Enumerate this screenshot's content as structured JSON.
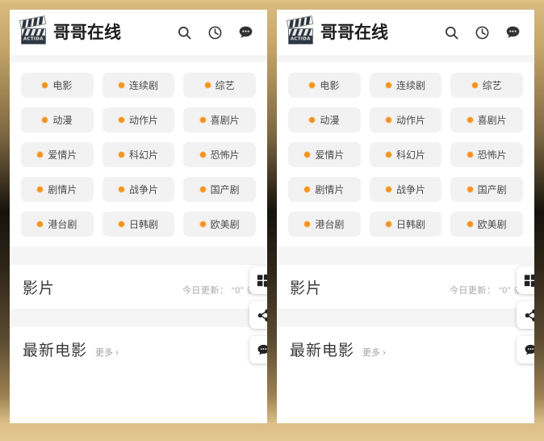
{
  "frame": {
    "border_color_top": "#e0c389",
    "border_color_mid": "#16120c",
    "border_color_bottom": "#e2c78e"
  },
  "header": {
    "brand_title": "哥哥在线",
    "logo_text": "ACTIDA",
    "icons": [
      {
        "name": "search-icon",
        "label": "搜索"
      },
      {
        "name": "history-clock-icon",
        "label": "历史"
      },
      {
        "name": "chat-bubble-icon",
        "label": "留言"
      }
    ]
  },
  "categories": [
    {
      "label": "电影",
      "dot_color": "#f7941d"
    },
    {
      "label": "连续剧",
      "dot_color": "#f7941d"
    },
    {
      "label": "综艺",
      "dot_color": "#f7941d"
    },
    {
      "label": "动漫",
      "dot_color": "#f7941d"
    },
    {
      "label": "动作片",
      "dot_color": "#f7941d"
    },
    {
      "label": "喜剧片",
      "dot_color": "#f7941d"
    },
    {
      "label": "爱情片",
      "dot_color": "#f7941d"
    },
    {
      "label": "科幻片",
      "dot_color": "#f7941d"
    },
    {
      "label": "恐怖片",
      "dot_color": "#f7941d"
    },
    {
      "label": "剧情片",
      "dot_color": "#f7941d"
    },
    {
      "label": "战争片",
      "dot_color": "#f7941d"
    },
    {
      "label": "国产剧",
      "dot_color": "#f7941d"
    },
    {
      "label": "港台剧",
      "dot_color": "#f7941d"
    },
    {
      "label": "日韩剧",
      "dot_color": "#f7941d"
    },
    {
      "label": "欧美剧",
      "dot_color": "#f7941d"
    }
  ],
  "sections": {
    "films": {
      "title": "影片",
      "subtitle": "今日更新： “0” 条"
    },
    "latest_movies": {
      "title": "最新电影",
      "more_label": "更多 ›"
    }
  },
  "fabs": [
    {
      "name": "app-grid-icon",
      "label": "应用"
    },
    {
      "name": "share-icon",
      "label": "分享"
    },
    {
      "name": "chat-bubble-icon",
      "label": "客服"
    }
  ]
}
